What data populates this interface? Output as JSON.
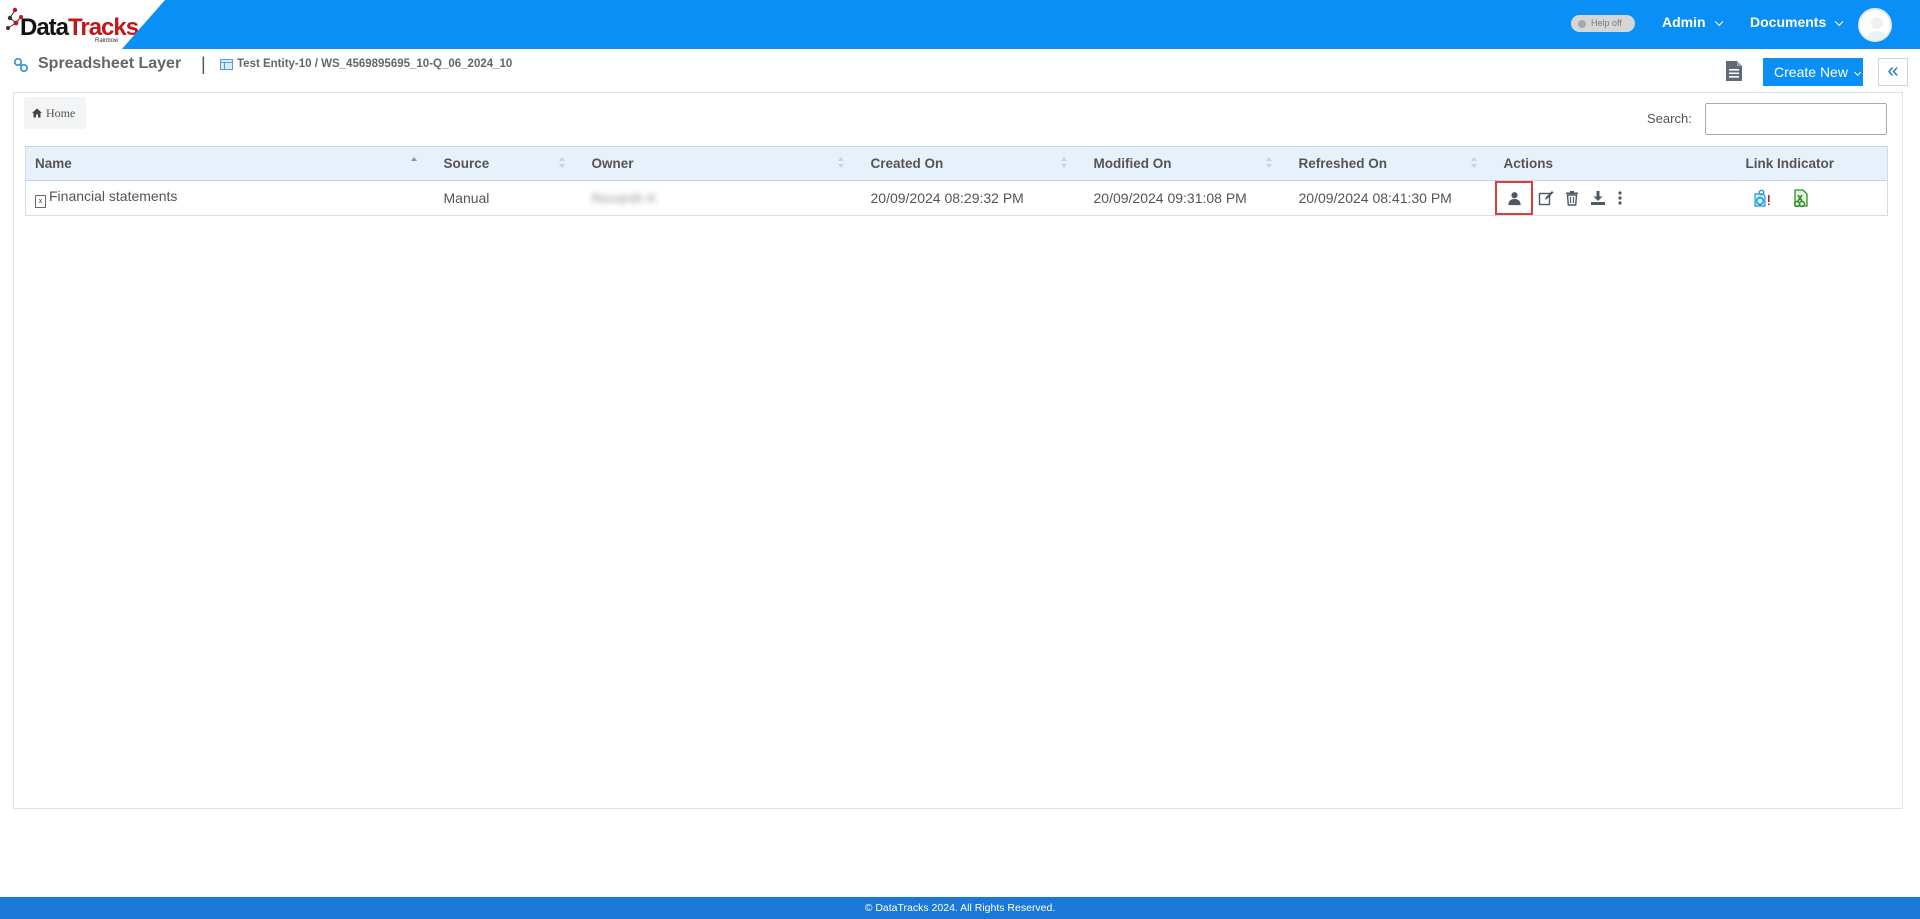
{
  "brand": {
    "logo_part1": "Data",
    "logo_part2": "Tracks",
    "logo_sub": "Rainbow"
  },
  "topbar": {
    "help_toggle": "Help off",
    "admin_menu": "Admin",
    "documents_menu": "Documents"
  },
  "header": {
    "title": "Spreadsheet Layer",
    "separator": "|",
    "breadcrumb_path": "Test Entity-10 / WS_4569895695_10-Q_06_2024_10",
    "create_new_label": "Create New",
    "collapse_label": "«"
  },
  "content": {
    "home_label": "Home",
    "search_label": "Search:",
    "search_value": ""
  },
  "table": {
    "columns": [
      "Name",
      "Source",
      "Owner",
      "Created On",
      "Modified On",
      "Refreshed On",
      "Actions",
      "Link Indicator"
    ],
    "rows": [
      {
        "name": "Financial statements",
        "source": "Manual",
        "owner": "Revanth K",
        "created_on": "20/09/2024 08:29:32 PM",
        "modified_on": "20/09/2024 09:31:08 PM",
        "refreshed_on": "20/09/2024 08:41:30 PM",
        "actions": [
          "user-icon",
          "edit-icon",
          "delete-icon",
          "download-icon",
          "more-vertical-icon"
        ],
        "link_indicators": [
          "linked-alert-icon",
          "excel-link-icon"
        ]
      }
    ]
  },
  "footer": {
    "copyright": "© DataTracks 2024. All Rights Reserved."
  },
  "colors": {
    "brand_blue": "#0a8ff7",
    "footer_blue": "#1a78d8",
    "highlight_red": "#e03b3b",
    "logo_red": "#c0171d"
  }
}
